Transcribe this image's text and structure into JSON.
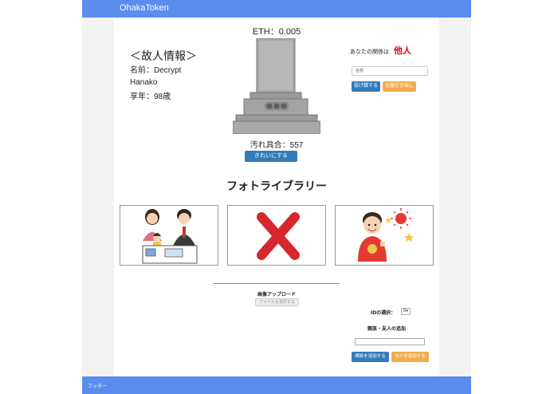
{
  "navbar": {
    "brand": "OhakaToken"
  },
  "deceased": {
    "title": "＜故人情報＞",
    "name": "名前：Decrypt Hanako",
    "age": "享年：98歳"
  },
  "grave": {
    "eth": "ETH：0.005",
    "dirt": "汚れ具合：557",
    "clean_label": "きれいにする"
  },
  "relation": {
    "label": "あなたの関係は",
    "value": "他人",
    "amount_placeholder": "金額",
    "donate_label": "投げ銭する",
    "withdraw_label": "全額引き出し"
  },
  "gallery": {
    "title": "フォトライブラリー",
    "photos": [
      {
        "icon": "family-photo-icon"
      },
      {
        "icon": "red-x-icon"
      },
      {
        "icon": "sun-boy-photo-icon"
      }
    ]
  },
  "upload": {
    "title": "画像アップロード",
    "file_label": "ファイルを選択する"
  },
  "members": {
    "id_label": "IDの選択：",
    "id_value": "0",
    "add_title": "親族・友人の追加",
    "add_family_label": "親族を追加する",
    "add_friend_label": "友人を追加する"
  },
  "footer": {
    "text": "フッター"
  },
  "colors": {
    "navbar": "#5b8def",
    "primary": "#337ab7",
    "warning": "#f0ad4e",
    "danger": "#ee0000"
  }
}
